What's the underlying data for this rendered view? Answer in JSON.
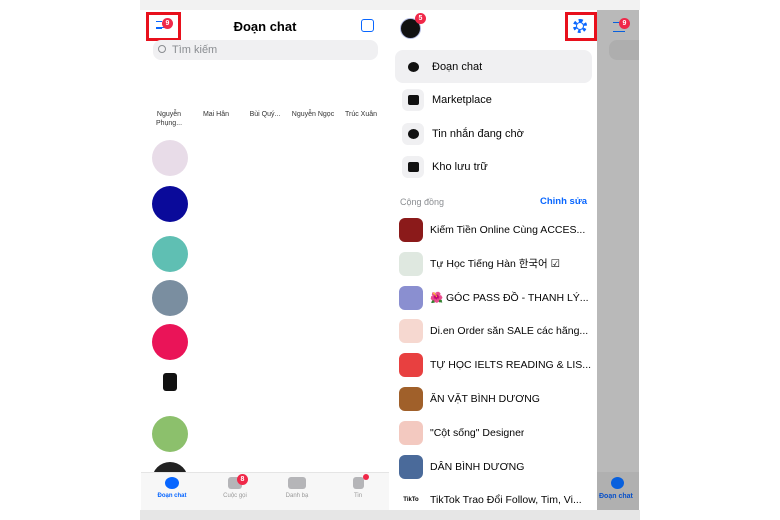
{
  "left": {
    "title": "Đoạn chat",
    "menu_badge": "9",
    "search_placeholder": "Tìm kiếm",
    "stories": [
      "Nguyễn Phụng...",
      "Mai Hân",
      "Bùi Quý...",
      "Nguyễn Ngọc",
      "Trúc Xuân"
    ],
    "chat_avatar_colors": [
      "#e8dce8",
      "#0a0a9a",
      "#5fbfb3",
      "#7a8ea0",
      "#ea1458",
      "#ffffff",
      "#8cc06c",
      "#222222"
    ],
    "tabs": [
      {
        "label": "Đoạn chat",
        "active": true
      },
      {
        "label": "Cuộc gọi",
        "badge": "8"
      },
      {
        "label": "Danh bạ"
      },
      {
        "label": "Tin",
        "dot": true
      }
    ]
  },
  "right": {
    "profile_badge": "5",
    "menu": [
      {
        "label": "Đoạn chat",
        "icon": "chat-bubble-icon",
        "active": true
      },
      {
        "label": "Marketplace",
        "icon": "store-icon"
      },
      {
        "label": "Tin nhắn đang chờ",
        "icon": "pending-chat-icon"
      },
      {
        "label": "Kho lưu trữ",
        "icon": "archive-icon"
      }
    ],
    "section_title": "Cộng đồng",
    "edit_label": "Chỉnh sửa",
    "communities": [
      "Kiếm Tiền Online Cùng ACCES...",
      "Tự Học Tiếng Hàn 한국어 ☑",
      "🌺 GÓC PASS ĐỒ - THANH LÝ...",
      "Di.en Order săn SALE các hãng...",
      "TỰ HỌC IELTS READING & LIS...",
      "ĂN VẶT BÌNH DƯƠNG",
      "\"Cột sống\" Designer",
      "DÂN BÌNH DƯƠNG",
      "TikTok Trao Đổi Follow, Tim, Vi..."
    ],
    "community_thumb_colors": [
      "#8b1a1a",
      "#dfe8e0",
      "#8a8fd0",
      "#f6d8d0",
      "#e84040",
      "#a0602a",
      "#f3c9c0",
      "#4a6a9a",
      "#ffffff"
    ],
    "tiktok_thumb_text": "TikTo",
    "shade_tab_label": "Đoạn chat"
  },
  "colors": {
    "accent": "#0866ff",
    "highlight": "#e8101c",
    "badge": "#f02849"
  }
}
